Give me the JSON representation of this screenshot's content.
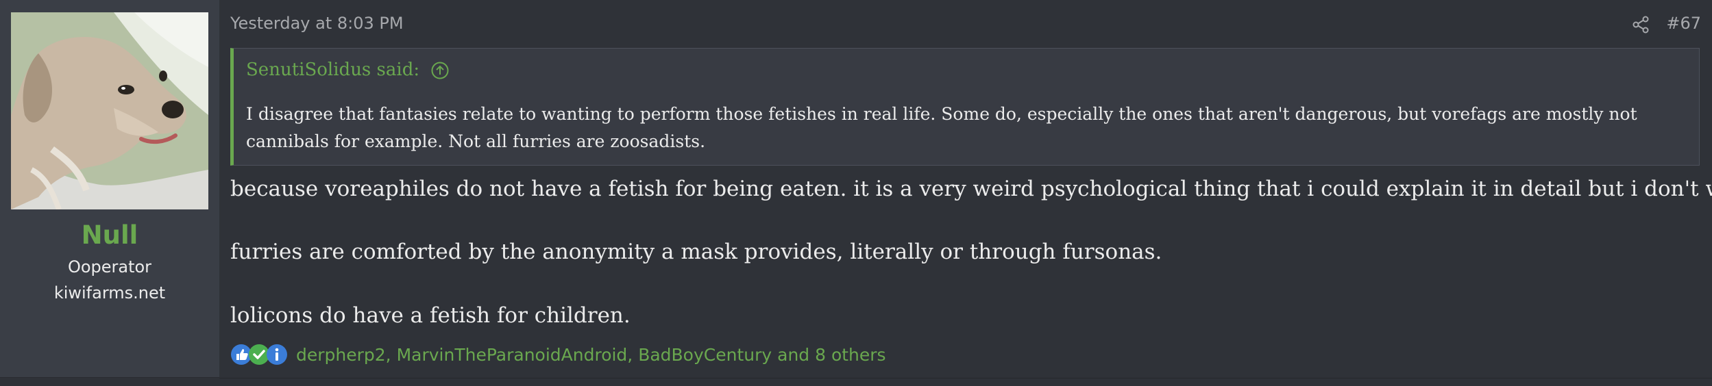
{
  "user": {
    "name": "Null",
    "title": "Ooperator",
    "site": "kiwifarms.net",
    "name_color": "#6aa84f"
  },
  "post": {
    "date": "Yesterday at 8:03 PM",
    "number": "#67",
    "share_icon": "share-icon"
  },
  "quote": {
    "author": "SenutiSolidus said:",
    "arrow_icon": "arrow-up-circle-icon",
    "body": "I disagree that fantasies relate to wanting to perform those fetishes in real life. Some do, especially the ones that aren't dangerous, but vorefags are mostly not cannibals for example. Not all furries are zoosadists.",
    "accent_color": "#6aa84f"
  },
  "message": {
    "paragraphs": [
      "because voreaphiles do not have a fetish for being eaten. it is a very weird psychological thing that i could explain it in detail but i don't want to.",
      "furries are comforted by the anonymity a mask provides, literally or through fursonas.",
      "lolicons do have a fetish for children."
    ]
  },
  "reactions": {
    "icons": [
      "thumbs-up-icon",
      "checkmark-icon",
      "info-icon"
    ],
    "text": "derpherp2, MarvinTheParanoidAndroid, BadBoyCentury and 8 others"
  }
}
